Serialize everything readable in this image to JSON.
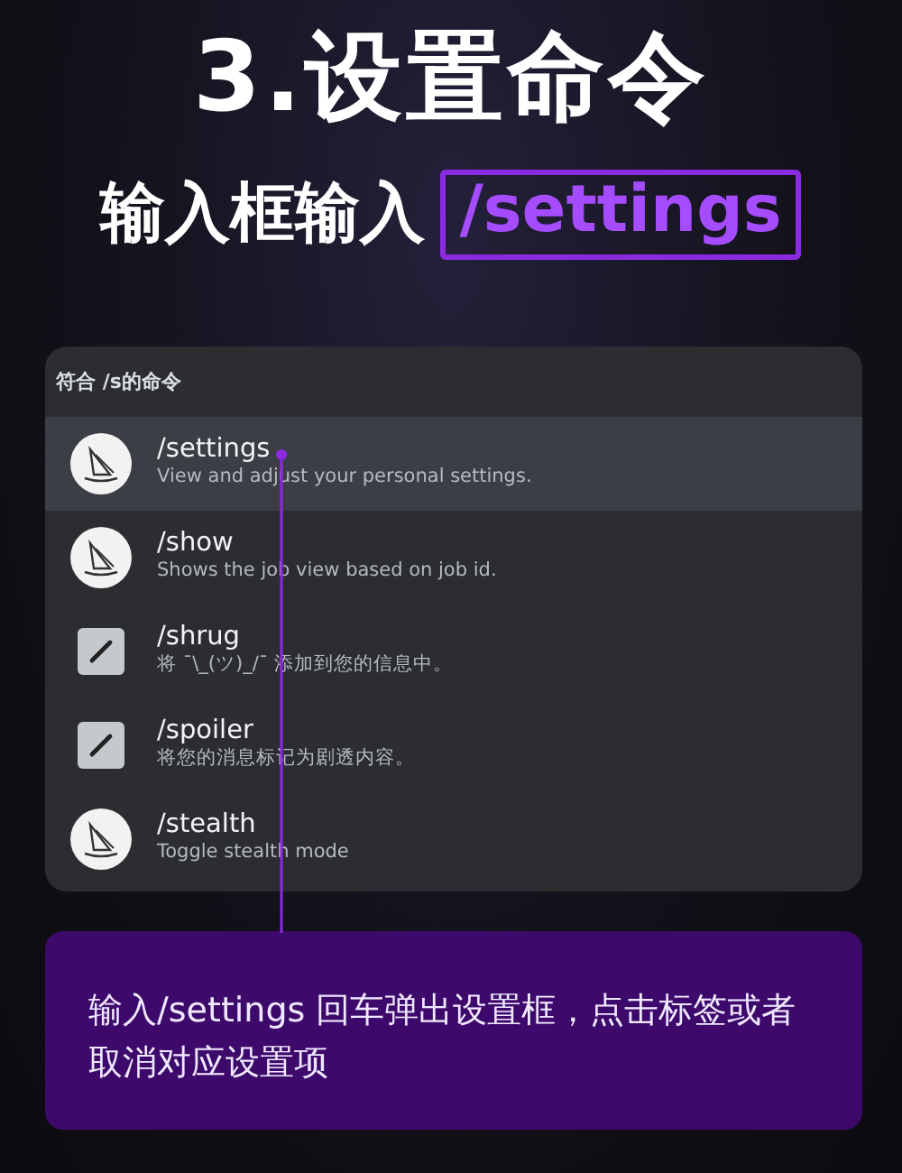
{
  "title": "3.设置命令",
  "subtitle": {
    "text": "输入框输入",
    "highlight": "/settings"
  },
  "command_list": {
    "header": "符合 /s的命令",
    "items": [
      {
        "kind": "bot",
        "name": "/settings",
        "description": "View and adjust your personal settings.",
        "selected": true
      },
      {
        "kind": "bot",
        "name": "/show",
        "description": "Shows the job view based on job id.",
        "selected": false
      },
      {
        "kind": "builtin",
        "name": "/shrug",
        "description": "将 ¯\\_(ツ)_/¯ 添加到您的信息中。",
        "selected": false
      },
      {
        "kind": "builtin",
        "name": "/spoiler",
        "description": "将您的消息标记为剧透内容。",
        "selected": false
      },
      {
        "kind": "bot",
        "name": "/stealth",
        "description": "Toggle stealth mode",
        "selected": false
      }
    ]
  },
  "callout": "输入/settings 回车弹出设置框，点击标签或者取消对应设置项"
}
